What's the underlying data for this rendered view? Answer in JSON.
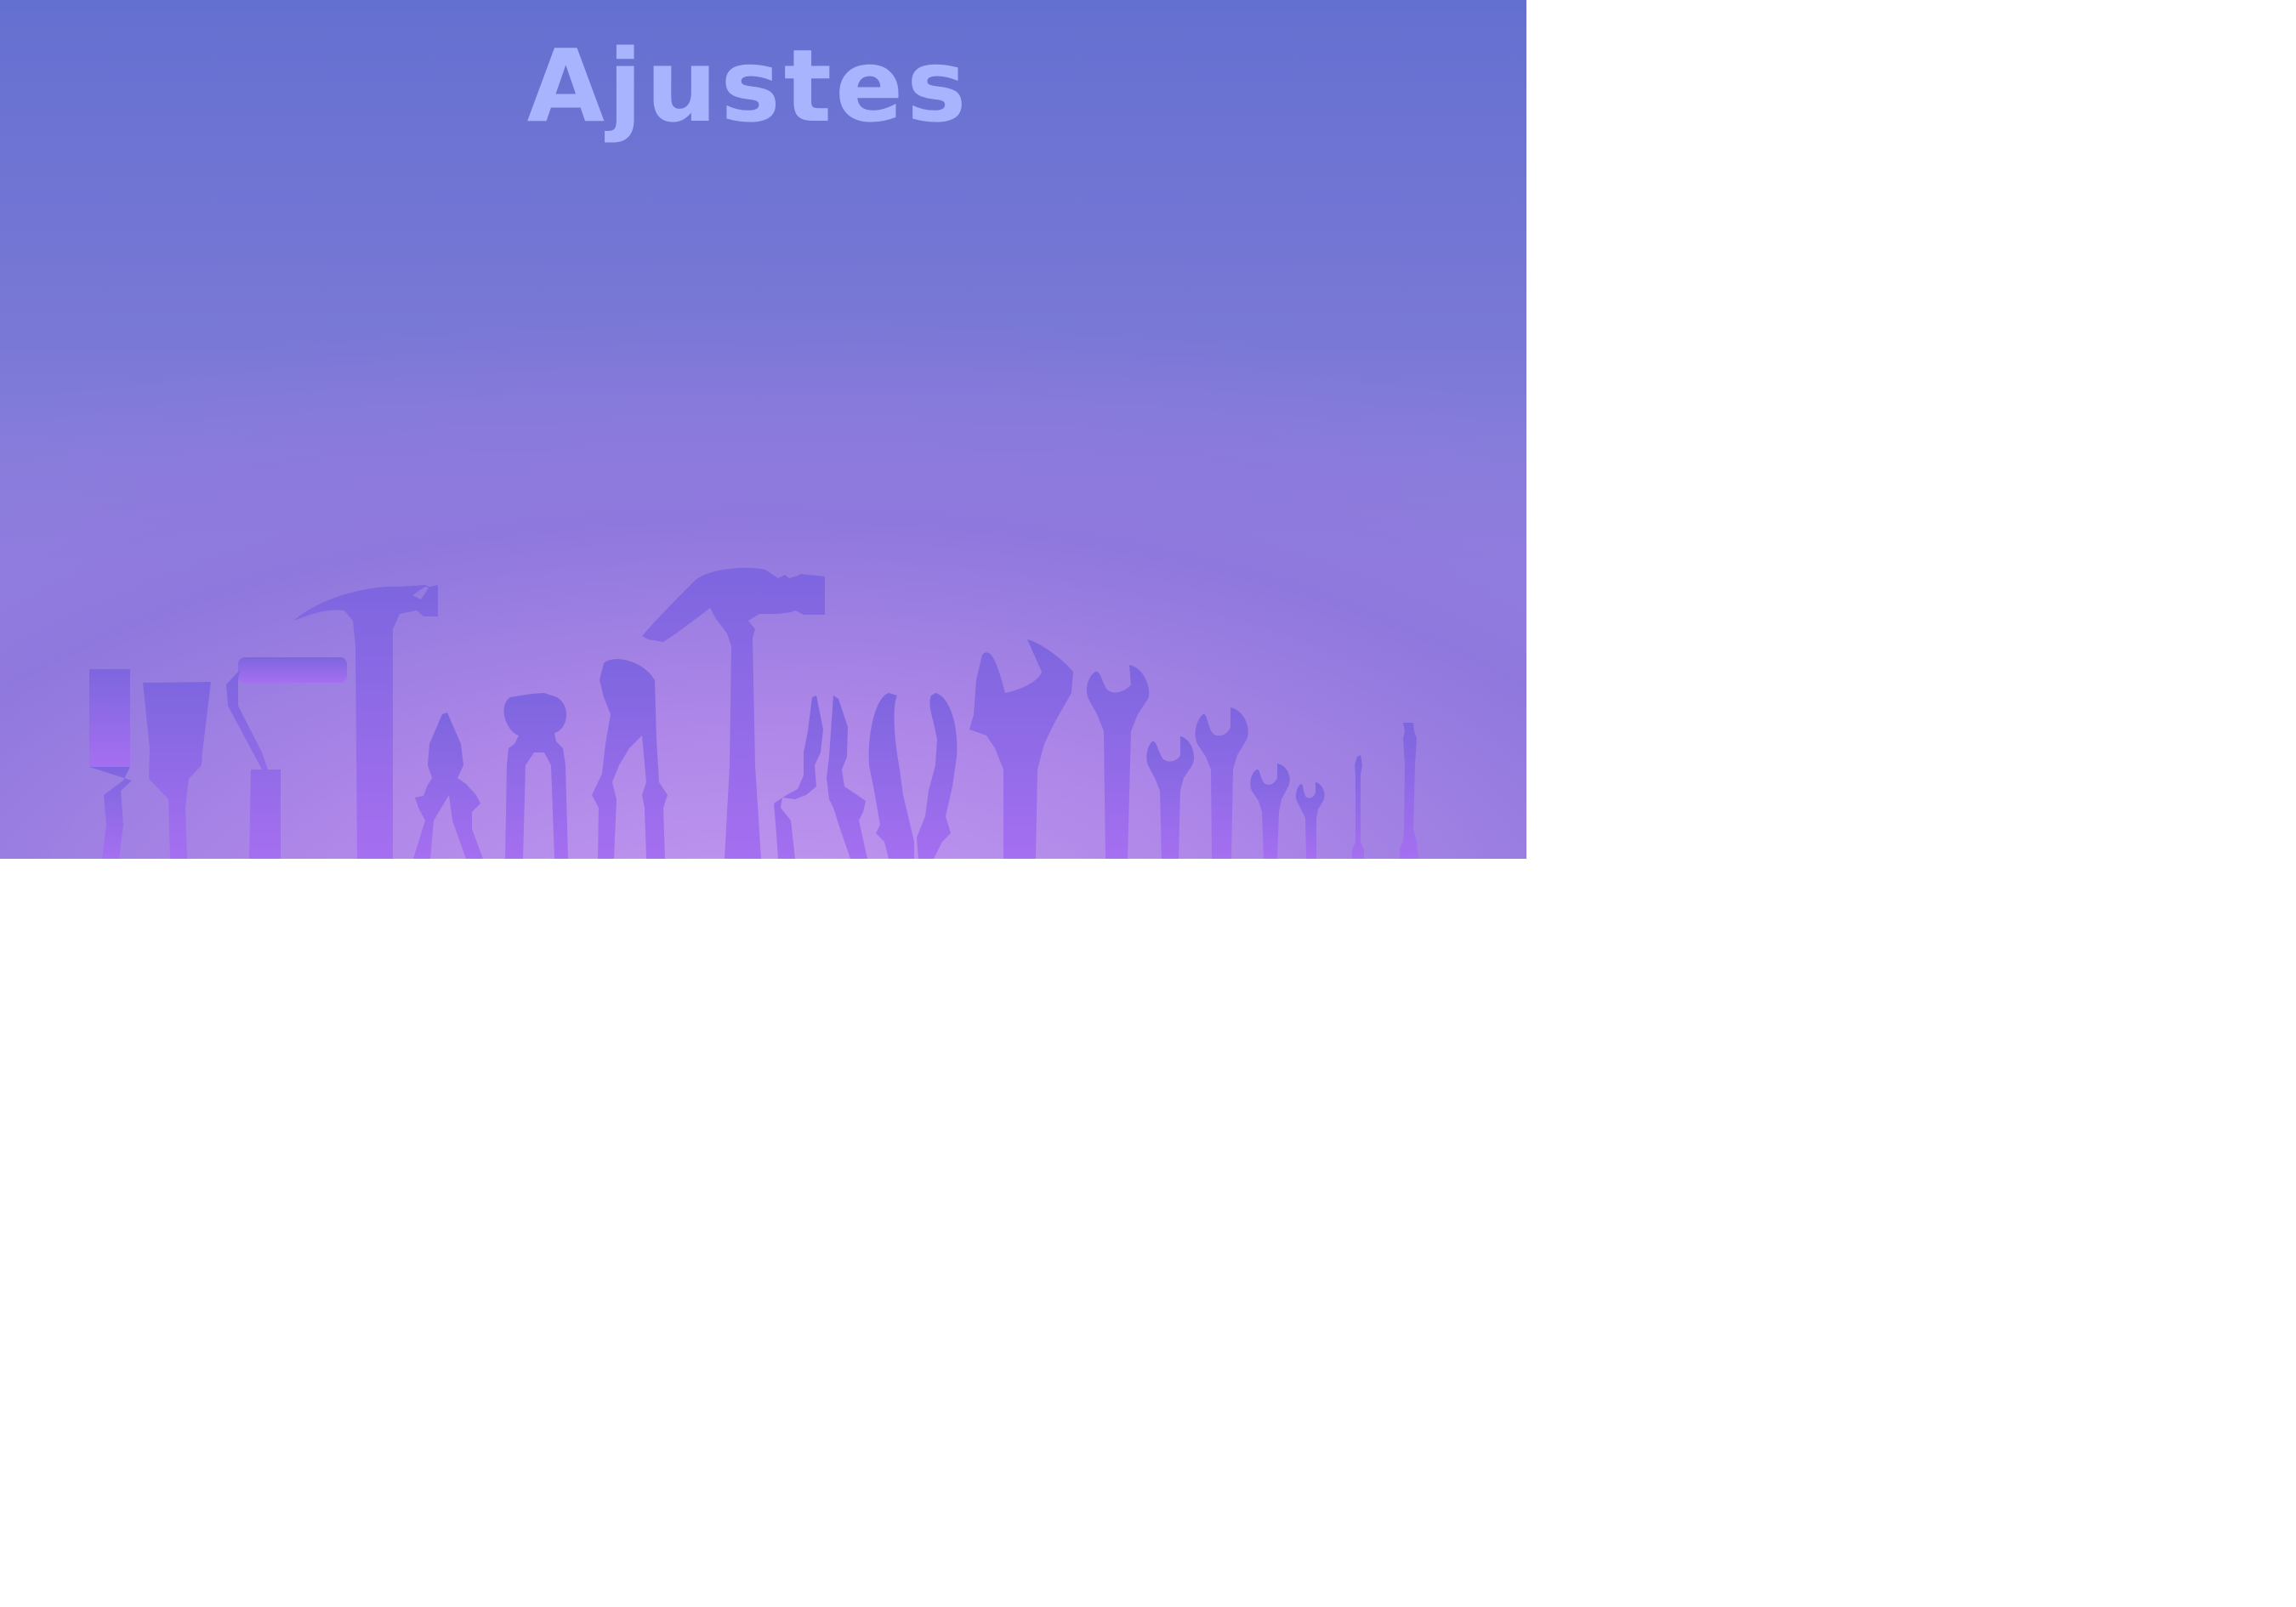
{
  "banner": {
    "title": "Ajustes",
    "title_color": "#a9b4ff",
    "gradient_top": "#6470d0",
    "gradient_bottom": "#c49af0"
  },
  "tools": {
    "icons": [
      "chisel-icon",
      "chisel-icon",
      "paint-roller-icon",
      "hammer-icon",
      "pliers-icon",
      "pincers-icon",
      "water-pump-pliers-icon",
      "hammer-icon",
      "pliers-icon",
      "pliers-icon",
      "adjustable-wrench-icon",
      "wrench-icon",
      "wrench-icon",
      "wrench-icon",
      "wrench-icon",
      "wrench-icon",
      "screwdriver-icon",
      "screwdriver-icon"
    ],
    "color_light": "#a46ff0",
    "color_dark": "#7d65de"
  }
}
